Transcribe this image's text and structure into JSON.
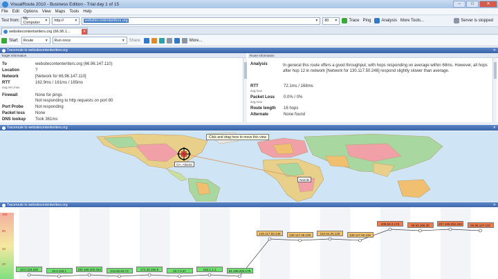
{
  "window": {
    "title": "VisualRoute 2010 - Business Edition - Trial day 1 of 15"
  },
  "menu": [
    "File",
    "Edit",
    "Options",
    "View",
    "Maps",
    "Tools",
    "Help"
  ],
  "addressbar": {
    "test_from_label": "Test from:",
    "test_from_value": "My Computer",
    "protocol_value": "http://",
    "target_value": "websitecontentwriters.org",
    "port_value": "80",
    "trace_label": "Trace",
    "ping_label": "Ping",
    "analysis_label": "Analysis",
    "more_tools_label": "More Tools...",
    "server_status": "Server is stopped"
  },
  "tab": {
    "label": "websitecontentwriters.org (66.96.1..."
  },
  "toolbar": {
    "start_label": "Start",
    "mode_label": "Route",
    "interval_value": "Run once",
    "share_label": "Share",
    "more_label": "More..."
  },
  "info_panel": {
    "header": "Traceroute to websitecontentwriters.org",
    "target_section": "Target Information",
    "route_section": "Route Information",
    "target_rows": [
      {
        "key": "To",
        "value": "websitecontentwriters.org (66.96.147.110)"
      },
      {
        "key": "Location",
        "value": "?"
      },
      {
        "key": "Network",
        "value": "[Network for 66.96.147.110]"
      },
      {
        "key": "RTT",
        "value": "162.9ms / 161ms / 165ms"
      },
      {
        "key": "Firewall",
        "value": "None for pings"
      },
      {
        "key": "",
        "value": "Not responding to http requests on port 80"
      },
      {
        "key": "Port Probe",
        "value": "Not responding"
      },
      {
        "key": "Packet loss",
        "value": "None"
      },
      {
        "key": "DNS lookup",
        "value": "Took 361ms"
      }
    ],
    "rtt_sub": "avg,min,max",
    "analysis_key": "Analysis",
    "analysis_text": "In general this route offers a good throughput, with hops responding on average within 68ms. However, all hops after hop 12 in network [Network for 130.117.50.246] respond slightly slower than average.",
    "route_rows": [
      {
        "key": "RTT",
        "value": "72.1ms / 168ms",
        "sub": "avg,max"
      },
      {
        "key": "Packet Loss",
        "value": "0.0% / 0%",
        "sub": "avg,max"
      },
      {
        "key": "Route length",
        "value": "16 hops",
        "sub": ""
      },
      {
        "key": "Alternate",
        "value": "None found",
        "sub": ""
      }
    ]
  },
  "map_panel": {
    "header": "Traceroute to websitecontentwriters.org",
    "tooltip": "Click and drag here to move this view",
    "label_atlanta": "GA, Atlanta",
    "label_africa": "Nairobi"
  },
  "graph_panel": {
    "header": "Traceroute to websitecontentwriters.org",
    "y_labels": [
      "100",
      "80",
      "40",
      "20"
    ],
    "hops": [
      {
        "label": "10.0.119.200",
        "level": "green"
      },
      {
        "label": "10.0.118.1",
        "level": "green"
      },
      {
        "label": "192.168.200.254",
        "level": "green"
      },
      {
        "label": "213.92.63.73",
        "level": "green"
      },
      {
        "label": "172.30.155.5",
        "level": "green"
      },
      {
        "label": "10.7.0.37",
        "level": "green"
      },
      {
        "label": "192.1.1.1",
        "level": "green"
      },
      {
        "label": "81.196.202.178",
        "level": "green"
      },
      {
        "label": "130.117.50.246",
        "level": "yellow"
      },
      {
        "label": "130.117.48.109",
        "level": "yellow"
      },
      {
        "label": "154.54.26.129",
        "level": "yellow"
      },
      {
        "label": "130.117.50.246",
        "level": "yellow"
      },
      {
        "label": "209.59.3.178",
        "level": "red"
      },
      {
        "label": "69.93.196.38",
        "level": "red"
      },
      {
        "label": "207.198.252.253",
        "level": "red"
      },
      {
        "label": "66.96.147.110",
        "level": "red"
      }
    ]
  },
  "colors": {
    "panel_header": "#3a64a8",
    "hop_green": "#6ee06e",
    "hop_yellow": "#f5c46a",
    "hop_red": "#f07a4a",
    "route_line": "#d9a070"
  }
}
